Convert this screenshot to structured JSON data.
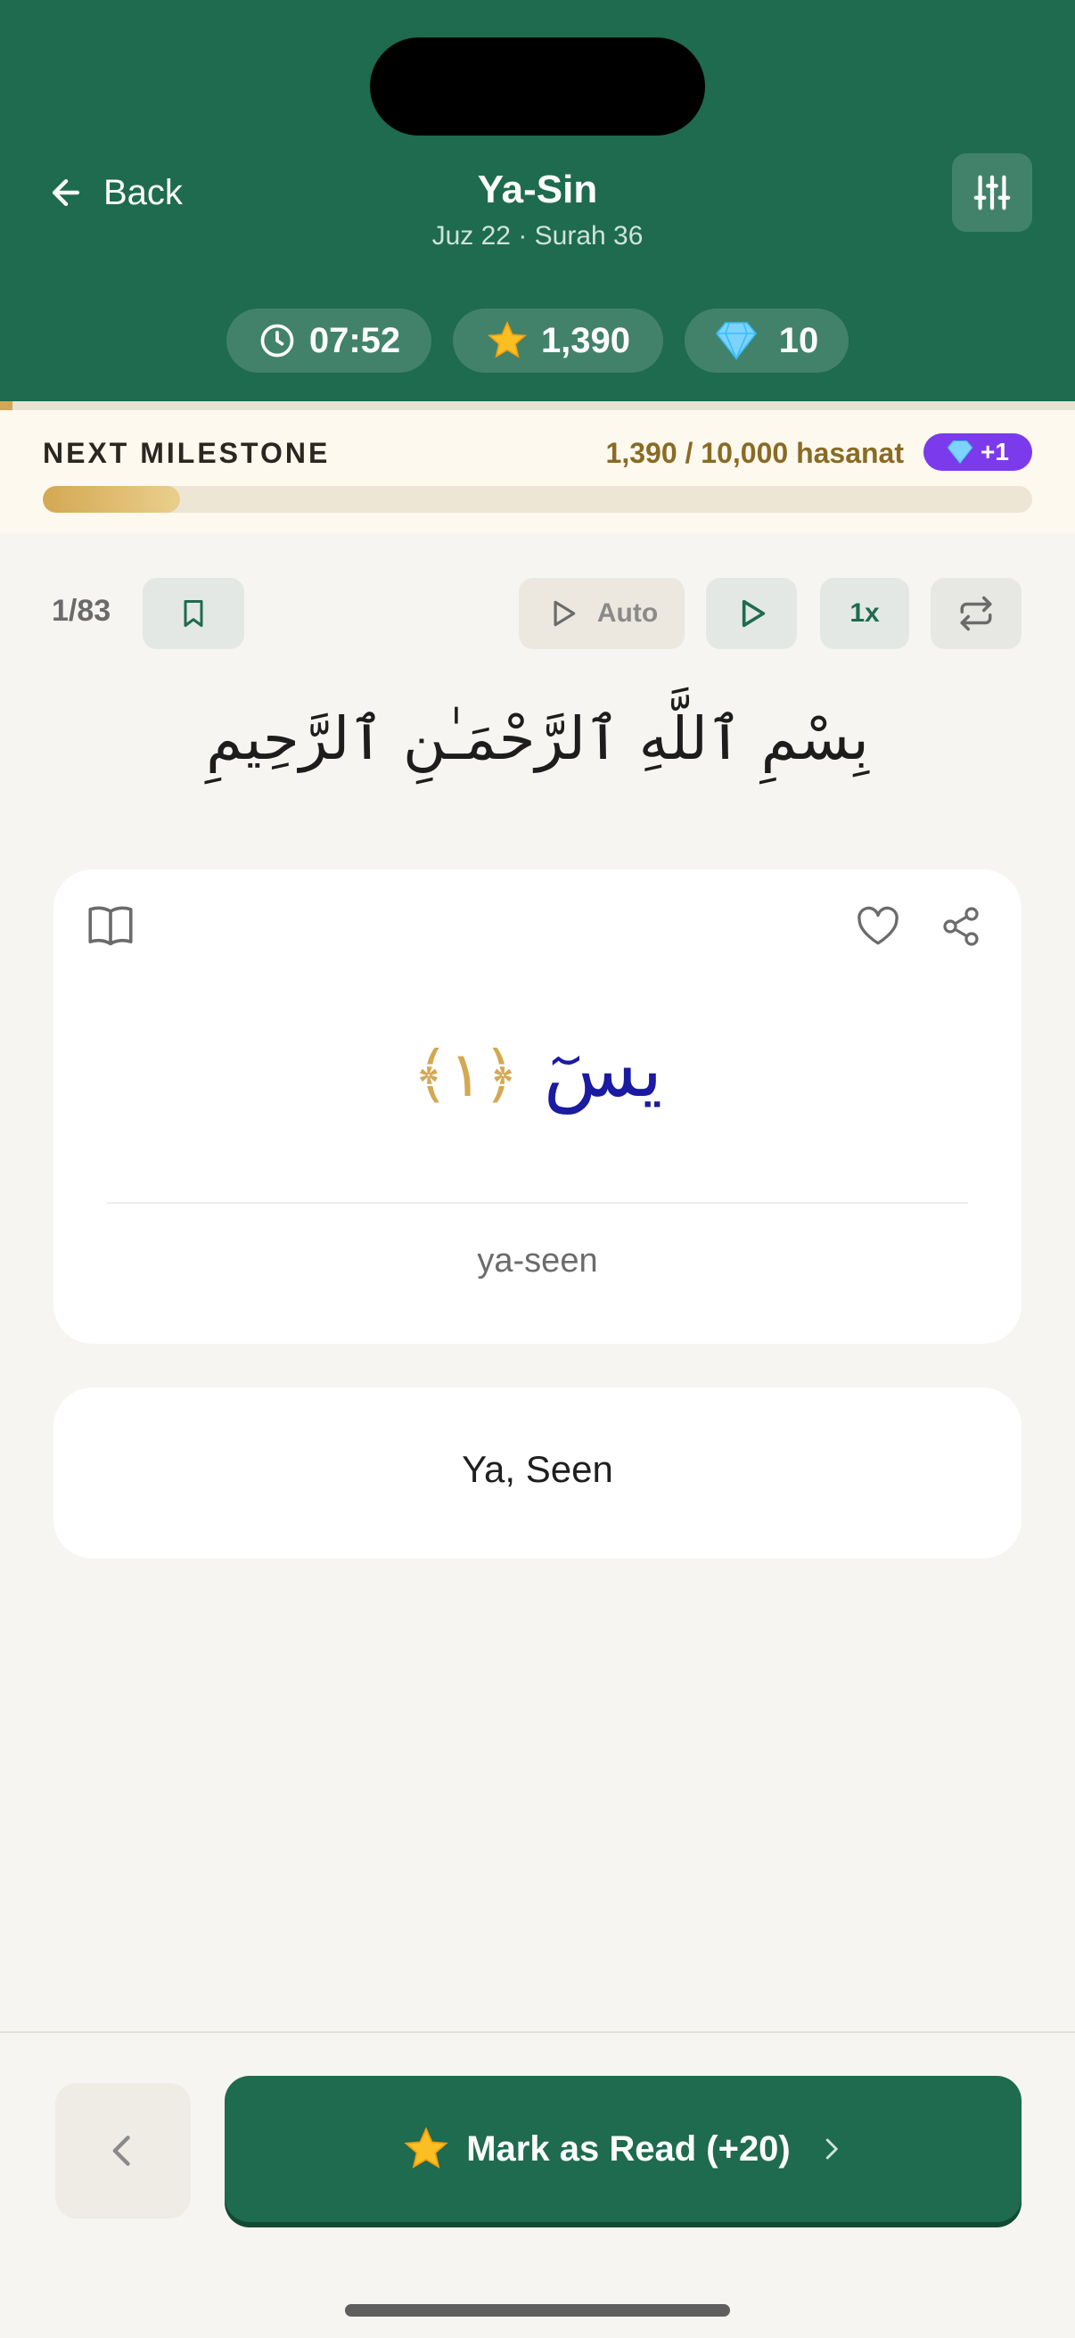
{
  "header": {
    "back_label": "Back",
    "title": "Ya-Sin",
    "subtitle": "Juz 22 · Surah 36",
    "stats": {
      "timer": "07:52",
      "stars": "1,390",
      "gems": "10"
    }
  },
  "milestone": {
    "label": "NEXT MILESTONE",
    "value_text": "1,390 / 10,000 hasanat",
    "badge": "+1",
    "progress": 0.139
  },
  "player": {
    "counter": "1/83",
    "auto_label": "Auto",
    "speed_label": "1x"
  },
  "bismillah": "بِسْمِ ٱللَّهِ ٱلرَّحْمَـٰنِ ٱلرَّحِيمِ",
  "verse": {
    "arabic": "يسٓ",
    "number": "﴿١﴾",
    "transliteration": "ya-seen",
    "translation": "Ya, Seen"
  },
  "footer": {
    "mark_label": "Mark as Read (+20)"
  },
  "colors": {
    "primary_green": "#1e6b4f",
    "gold": "#d4a853",
    "verse_blue": "#1a1aa3",
    "badge_purple": "#7c3aed"
  },
  "icons": {
    "back": "arrow-left-icon",
    "settings": "sliders-icon",
    "timer": "clock-icon",
    "stars": "star-icon",
    "gems": "gem-icon",
    "bookmark": "bookmark-icon",
    "auto": "play-outline-icon",
    "play": "play-icon",
    "repeat": "repeat-icon",
    "book": "book-open-icon",
    "heart": "heart-icon",
    "share": "share-icon",
    "prev": "chevron-left-icon",
    "next": "chevron-right-icon"
  }
}
